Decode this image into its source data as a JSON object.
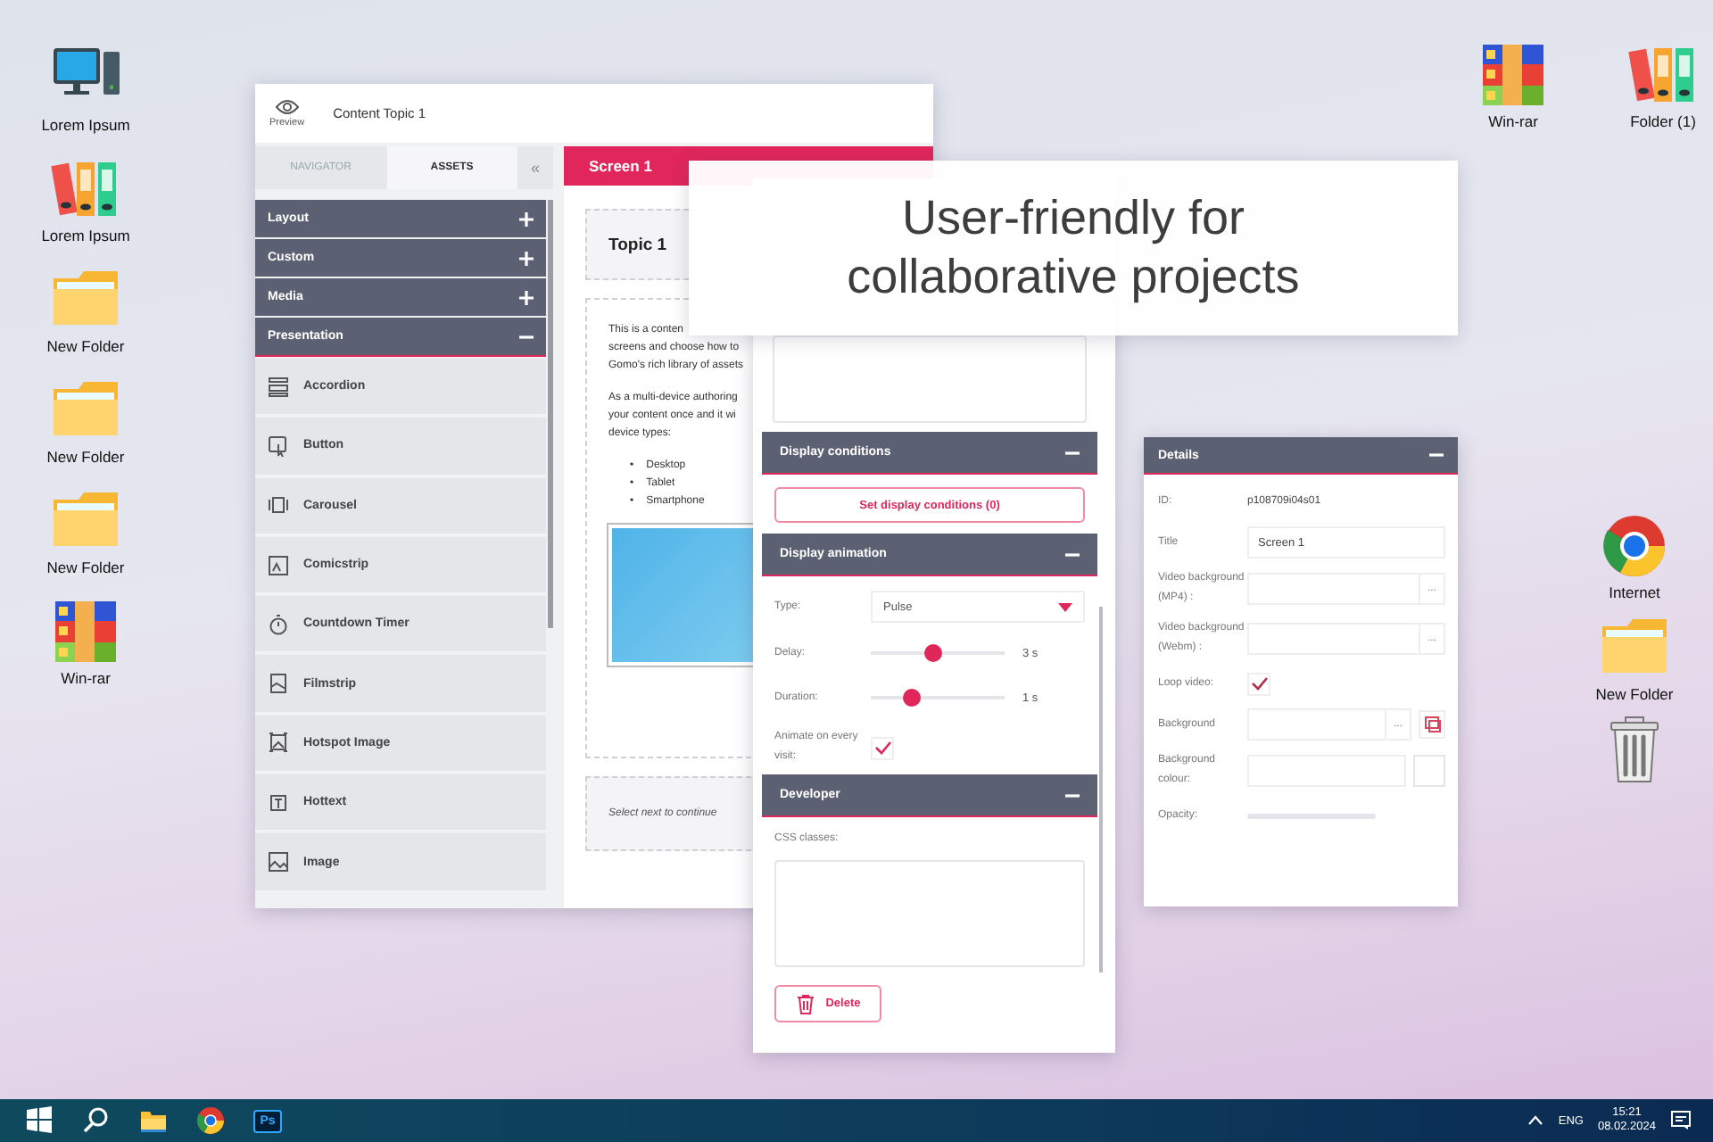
{
  "desktop_left": [
    {
      "kind": "monitor",
      "label": "Lorem Ipsum"
    },
    {
      "kind": "binders",
      "label": "Lorem Ipsum"
    },
    {
      "kind": "folder",
      "label": "New Folder"
    },
    {
      "kind": "folder",
      "label": "New Folder"
    },
    {
      "kind": "folder",
      "label": "New Folder"
    },
    {
      "kind": "winrar",
      "label": "Win-rar"
    }
  ],
  "desktop_right_top": [
    {
      "kind": "winrar",
      "label": "Win-rar"
    },
    {
      "kind": "binders",
      "label": "Folder (1)"
    }
  ],
  "desktop_right": [
    {
      "kind": "chrome",
      "label": "Internet"
    },
    {
      "kind": "folder",
      "label": "New Folder"
    },
    {
      "kind": "trash"
    }
  ],
  "editor": {
    "preview_label": "Preview",
    "title": "Content Topic 1",
    "tabs": [
      {
        "label": "NAVIGATOR",
        "selected": false
      },
      {
        "label": "ASSETS",
        "selected": true
      }
    ],
    "collapse": "«",
    "categories": [
      {
        "label": "Layout",
        "expanded": false
      },
      {
        "label": "Custom",
        "expanded": false
      },
      {
        "label": "Media",
        "expanded": false
      },
      {
        "label": "Presentation",
        "expanded": true
      }
    ],
    "assets": [
      {
        "kind": "accordion",
        "label": "Accordion"
      },
      {
        "kind": "button",
        "label": "Button"
      },
      {
        "kind": "carousel",
        "label": "Carousel"
      },
      {
        "kind": "comicstrip",
        "label": "Comicstrip"
      },
      {
        "kind": "timer",
        "label": "Countdown Timer"
      },
      {
        "kind": "filmstrip",
        "label": "Filmstrip"
      },
      {
        "kind": "hotspot",
        "label": "Hotspot Image"
      },
      {
        "kind": "hottext",
        "label": "Hottext"
      },
      {
        "kind": "image",
        "label": "Image"
      }
    ],
    "screen_title": "Screen 1",
    "topic_title": "Topic 1",
    "paragraph_1": [
      "This is a conten",
      "screens and choose how to",
      "Gomo's rich library of assets"
    ],
    "paragraph_2": [
      "As a multi-device authoring",
      "your content once and it wi",
      "device types:"
    ],
    "marker": "•",
    "bullets": [
      "Desktop",
      "Tablet",
      "Smartphone"
    ],
    "footer": "Select next to continue"
  },
  "properties": {
    "sections": [
      {
        "title": "Display conditions",
        "expanded": true
      },
      {
        "title": "Display animation",
        "expanded": true
      },
      {
        "title": "Developer",
        "expanded": true
      }
    ],
    "conditions_button": "Set display conditions (0)",
    "type_label": "Type:",
    "type_value": "Pulse",
    "delay": {
      "label": "Delay:",
      "level": 0.47,
      "reading": "3 s"
    },
    "duration": {
      "label": "Duration:",
      "level": 0.3,
      "reading": "1 s"
    },
    "animate": {
      "label": "Animate on every visit:",
      "checked": true
    },
    "css_label": "CSS classes:",
    "delete_label": "Delete"
  },
  "details": {
    "title": "Details",
    "expanded": true,
    "fields": [
      {
        "kind": "text",
        "label": "ID:",
        "value": "p108709i04s01"
      },
      {
        "kind": "input",
        "label": "Title",
        "value": "Screen 1"
      },
      {
        "kind": "browse",
        "label": "Video background (MP4) :",
        "button": "..."
      },
      {
        "kind": "browse",
        "label": "Video background (Webm) :",
        "button": "..."
      },
      {
        "kind": "checkbox",
        "label": "Loop video:",
        "checked": true
      },
      {
        "kind": "image",
        "label": "Background",
        "button": "..."
      },
      {
        "kind": "colour",
        "label": "Background colour:"
      },
      {
        "kind": "bar",
        "label": "Opacity:",
        "level": 1
      }
    ]
  },
  "banner": {
    "lines": [
      "User-friendly for",
      "collaborative projects"
    ]
  },
  "taskbar": {
    "apps": [
      {
        "kind": "windows"
      },
      {
        "kind": "search"
      },
      {
        "kind": "explorer"
      },
      {
        "kind": "chrome"
      },
      {
        "kind": "photoshop",
        "text": "Ps"
      }
    ],
    "language": "ENG",
    "time": "15:21",
    "date": "08.02.2024"
  }
}
